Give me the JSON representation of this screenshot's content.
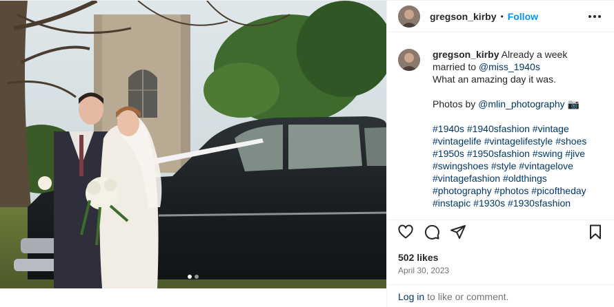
{
  "post": {
    "username": "gregson_kirby",
    "separator": "•",
    "follow_label": "Follow",
    "caption": {
      "username": "gregson_kirby",
      "line1_text": "Already a week",
      "line2_prefix": "married to ",
      "line2_mention": "@miss_1940s",
      "line3": "What an amazing day it was.",
      "photos_prefix": "Photos by ",
      "photos_mention": "@mlin_photography",
      "photos_emoji": "📷",
      "hashtags": [
        [
          "#1940s",
          "#1940sfashion",
          "#vintage"
        ],
        [
          "#vintagelife",
          "#vintagelifestyle",
          "#shoes"
        ],
        [
          "#1950s",
          "#1950sfashion",
          "#swing",
          "#jive"
        ],
        [
          "#swingshoes",
          "#style",
          "#vintagelove"
        ],
        [
          "#vintagefashion",
          "#oldthings"
        ],
        [
          "#photography",
          "#photos",
          "#picoftheday"
        ],
        [
          "#instapic",
          "#1930s",
          "#1930sfashion"
        ]
      ]
    },
    "likes": "502 likes",
    "date": "April 30, 2023",
    "carousel_count": 2,
    "carousel_active": 1
  },
  "footer": {
    "login_link": "Log in",
    "login_rest": "to like or comment."
  },
  "icons": {
    "more": "more-options-icon",
    "like": "heart-icon",
    "comment": "comment-icon",
    "share": "share-icon",
    "save": "bookmark-icon"
  },
  "colors": {
    "link_blue": "#0095f6",
    "mention": "#00376b",
    "muted": "#737373",
    "text": "#262626"
  }
}
